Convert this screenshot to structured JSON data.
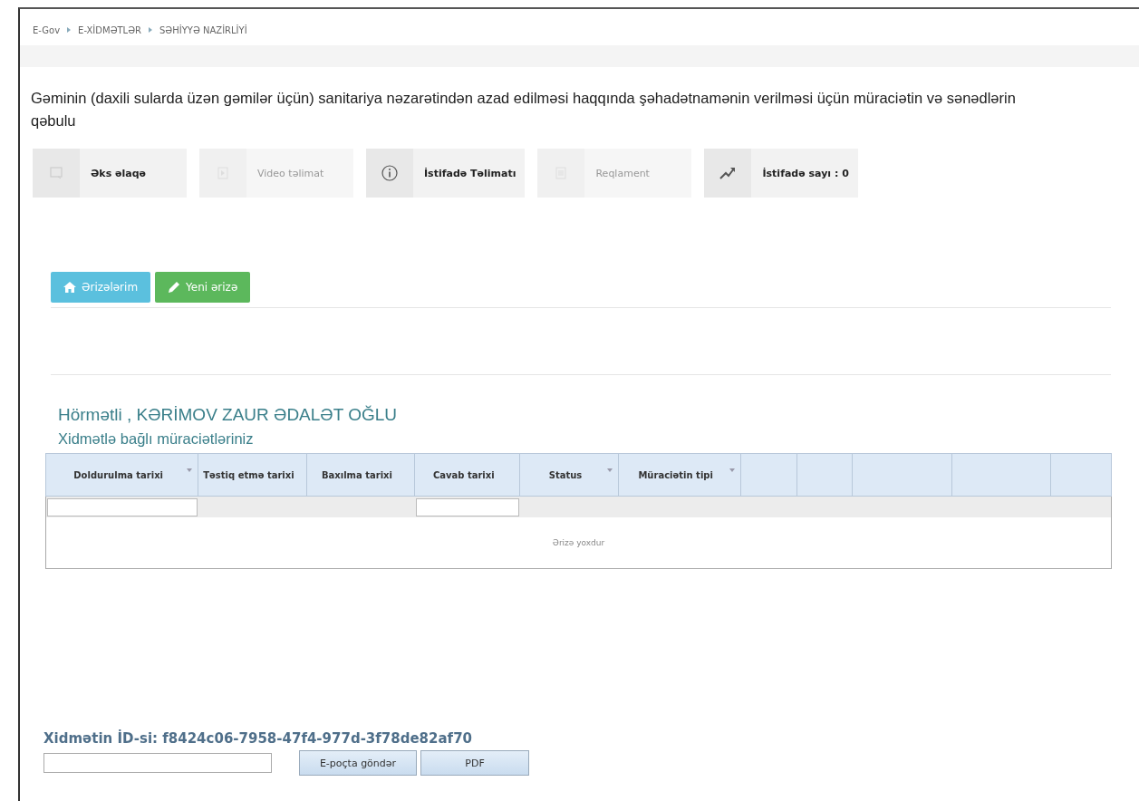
{
  "breadcrumb": [
    "E-Gov",
    "E-XİDMƏTLƏR",
    "SƏHİYYƏ NAZİRLİYİ"
  ],
  "title": "Gəminin (daxili sularda üzən gəmilər üçün) sanitariya nəzarətindən azad edilməsi haqqında şəhadətnamənin verilməsi üçün müraciətin və sənədlərin qəbulu",
  "toolbar": [
    {
      "kind": "chat",
      "label": "Əks əlaqə",
      "disabled": false
    },
    {
      "kind": "video",
      "label": "Video təlimat",
      "disabled": true
    },
    {
      "kind": "info",
      "label": "İstifadə Təlimatı",
      "disabled": false
    },
    {
      "kind": "doc",
      "label": "Reqlament",
      "disabled": true
    },
    {
      "kind": "chart",
      "label": "İstifadə sayı : 0",
      "disabled": false
    }
  ],
  "tabs": [
    {
      "kind": "home",
      "label": "Ərizələrim"
    },
    {
      "kind": "edit",
      "label": "Yeni ərizə"
    }
  ],
  "greeting": "Hörmətli , KƏRİMOV ZAUR ƏDALƏT OĞLU",
  "subtitle": "Xidmətlə bağlı müraciətləriniz",
  "table": {
    "columns": [
      {
        "label": "Doldurulma tarixi",
        "sortable": true,
        "filter": true
      },
      {
        "label": "Təstiq etmə tarixi",
        "sortable": false,
        "filter": false
      },
      {
        "label": "Baxılma tarixi",
        "sortable": false,
        "filter": false
      },
      {
        "label": "Cavab tarixi",
        "sortable": false,
        "filter": true
      },
      {
        "label": "Status",
        "sortable": true,
        "filter": false
      },
      {
        "label": "Müraciətin tipi",
        "sortable": true,
        "filter": false
      },
      {
        "sortable": false,
        "filter": false
      },
      {
        "sortable": false,
        "filter": false
      },
      {
        "sortable": false,
        "filter": false
      },
      {
        "sortable": false,
        "filter": false
      },
      {
        "sortable": false,
        "filter": false
      }
    ],
    "empty_message": "Ərizə yoxdur"
  },
  "service_id": "Xidmətin İD-si: f8424c06-7958-47f4-977d-3f78de82af70",
  "email_button": "E-poçta göndər",
  "pdf_button": "PDF"
}
